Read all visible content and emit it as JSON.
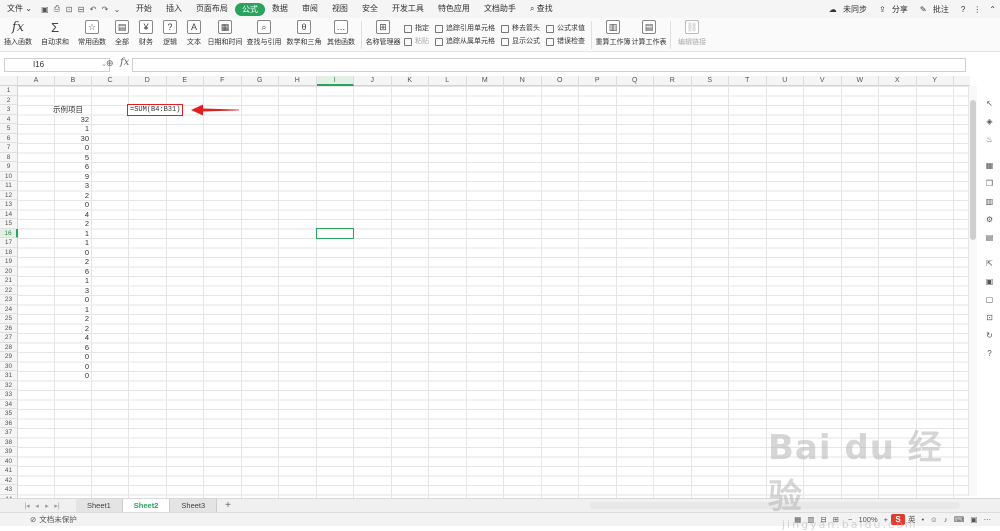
{
  "menubar": {
    "file": "文件",
    "file_arrow": "⌄",
    "quick_access": [
      "▣",
      "⎙",
      "⊡",
      "⊟",
      "↶",
      "↷",
      "⌄"
    ],
    "tabs": [
      {
        "label": "开始",
        "active": false
      },
      {
        "label": "插入",
        "active": false
      },
      {
        "label": "页面布局",
        "active": false
      },
      {
        "label": "公式",
        "active": true
      },
      {
        "label": "数据",
        "active": false
      },
      {
        "label": "审阅",
        "active": false
      },
      {
        "label": "视图",
        "active": false
      },
      {
        "label": "安全",
        "active": false
      },
      {
        "label": "开发工具",
        "active": false
      },
      {
        "label": "特色应用",
        "active": false
      },
      {
        "label": "文档助手",
        "active": false
      }
    ],
    "search": "查找",
    "sync": "未同步",
    "share": "分享",
    "comment": "批注",
    "help": "?",
    "more": "⋮",
    "collapse": "⌃"
  },
  "ribbon": {
    "insert_function": "插入函数",
    "autosum": "自动求和",
    "common_functions": "常用函数",
    "all": "全部",
    "finance": "财务",
    "logic": "逻辑",
    "text": "文本",
    "datetime": "日期和时间",
    "lookup": "查找与引用",
    "math": "数学和三角",
    "other": "其他函数",
    "name_manager": "名称管理器",
    "paste": "指定",
    "paste2": "粘贴",
    "trace_precedents": "追踪引用单元格",
    "trace_dependents": "追踪从属单元格",
    "remove_arrows": "移去箭头",
    "show_formulas": "显示公式",
    "evaluate": "公式求值",
    "error_check": "错误检查",
    "recalc_workbook": "重算工作簿",
    "calc_sheet": "计算工作表",
    "edit_links": "编辑链接"
  },
  "formula_bar": {
    "cell_ref": "I16",
    "dropdown_arrow": "⌄",
    "zoom_icon": "⊕",
    "fx": "fx"
  },
  "grid": {
    "columns": [
      "A",
      "B",
      "C",
      "D",
      "E",
      "F",
      "G",
      "H",
      "I",
      "J",
      "K",
      "L",
      "M",
      "N",
      "O",
      "P",
      "Q",
      "R",
      "S",
      "T",
      "U",
      "V",
      "W",
      "X",
      "Y"
    ],
    "row_count": 44,
    "selected_col": "I",
    "selected_row": 16,
    "header_label": "示例项目",
    "values": [
      "32",
      "1",
      "30",
      "0",
      "5",
      "6",
      "9",
      "3",
      "2",
      "0",
      "4",
      "2",
      "1",
      "1",
      "0",
      "2",
      "6",
      "1",
      "3",
      "0",
      "1",
      "2",
      "2",
      "4",
      "6",
      "0",
      "0",
      "0"
    ],
    "formula_text": "=SUM(B4:B31)"
  },
  "sidebar_icons": [
    "↖",
    "◈",
    "♨",
    "▦",
    "❒",
    "▥",
    "⚙",
    "▤",
    "⇱",
    "▣",
    "▢",
    "⊡",
    "↻",
    "?"
  ],
  "sheet_tabs": [
    {
      "label": "Sheet1",
      "active": false
    },
    {
      "label": "Sheet2",
      "active": true
    },
    {
      "label": "Sheet3",
      "active": false
    }
  ],
  "tab_nav": [
    "|◂",
    "◂",
    "▸",
    "▸|"
  ],
  "add_tab": "+",
  "statusbar": {
    "protect": "文档未保护",
    "zoom": "100%",
    "ime": "英",
    "view_icons": [
      "▦",
      "▥",
      "⊟",
      "⊞"
    ],
    "zoom_controls": [
      "−",
      "+"
    ]
  },
  "watermark": {
    "logo": "Bai du 经验",
    "url": "jingyan.baidu.com"
  },
  "colors": {
    "accent": "#2aa35e",
    "highlight": "#e02020"
  }
}
